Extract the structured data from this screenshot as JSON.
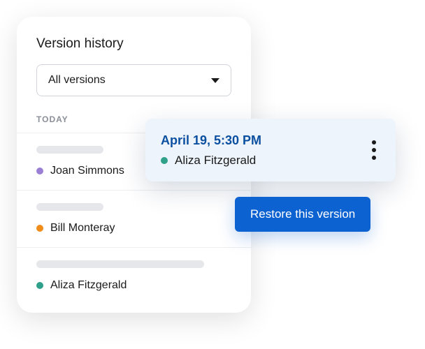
{
  "panel": {
    "title": "Version history",
    "dropdown": {
      "label": "All versions"
    },
    "section_label": "TODAY",
    "items": [
      {
        "name": "Joan Simmons",
        "color": "#9b7fd4",
        "skeleton_width": 96
      },
      {
        "name": "Bill Monteray",
        "color": "#f08c1a",
        "skeleton_width": 96
      },
      {
        "name": "Aliza Fitzgerald",
        "color": "#2fa08a",
        "skeleton_width": 240
      }
    ]
  },
  "popup": {
    "timestamp": "April 19, 5:30 PM",
    "author": "Aliza Fitzgerald",
    "author_color": "#2fa08a"
  },
  "restore_label": "Restore this version"
}
